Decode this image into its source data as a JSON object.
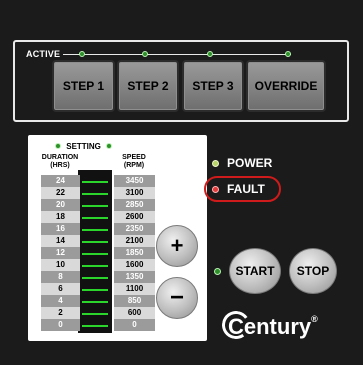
{
  "top": {
    "active_label": "ACTIVE",
    "buttons": [
      {
        "label": "STEP 1"
      },
      {
        "label": "STEP 2"
      },
      {
        "label": "STEP 3"
      },
      {
        "label": "OVERRIDE"
      }
    ]
  },
  "settings": {
    "title": "SETTING",
    "duration_label": "DURATION",
    "duration_unit": "(HRS)",
    "speed_label": "SPEED",
    "speed_unit": "(RPM)",
    "rows": [
      {
        "hours": "24",
        "rpm": "3450"
      },
      {
        "hours": "22",
        "rpm": "3100"
      },
      {
        "hours": "20",
        "rpm": "2850"
      },
      {
        "hours": "18",
        "rpm": "2600"
      },
      {
        "hours": "16",
        "rpm": "2350"
      },
      {
        "hours": "14",
        "rpm": "2100"
      },
      {
        "hours": "12",
        "rpm": "1850"
      },
      {
        "hours": "10",
        "rpm": "1600"
      },
      {
        "hours": "8",
        "rpm": "1350"
      },
      {
        "hours": "6",
        "rpm": "1100"
      },
      {
        "hours": "4",
        "rpm": "850"
      },
      {
        "hours": "2",
        "rpm": "600"
      },
      {
        "hours": "0",
        "rpm": "0"
      }
    ]
  },
  "status": {
    "power_label": "POWER",
    "fault_label": "FAULT",
    "colors": {
      "power": "#b8d36a",
      "fault": "#e03a3a",
      "ring": "#cf1b1b",
      "active_led": "#2f8f2a"
    }
  },
  "controls": {
    "plus": "+",
    "minus": "−",
    "start": "START",
    "stop": "STOP"
  },
  "brand": {
    "logo_text": "Century",
    "logo_mark": "®"
  }
}
